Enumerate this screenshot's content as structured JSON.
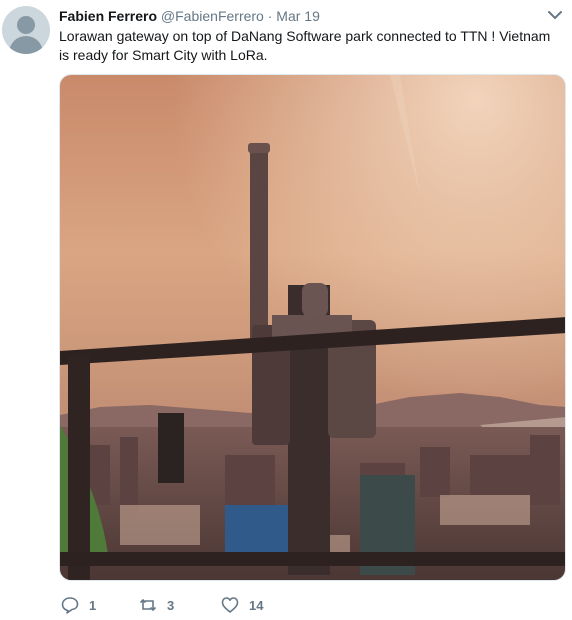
{
  "tweet": {
    "author_name": "Fabien Ferrero",
    "author_handle": "@FabienFerrero",
    "separator": "·",
    "timestamp": "Mar 19",
    "text": "Lorawan gateway on top of DaNang Software park connected to TTN ! Vietnam is ready for Smart City with LoRa."
  },
  "actions": {
    "reply_count": "1",
    "retweet_count": "3",
    "like_count": "14"
  },
  "icons": {
    "avatar": "default-avatar-icon",
    "menu": "chevron-down-icon",
    "reply": "reply-icon",
    "retweet": "retweet-icon",
    "like": "heart-icon"
  },
  "colors": {
    "name": "#14171a",
    "secondary": "#657786",
    "avatar_bg": "#ccd6dd",
    "icon": "#657786"
  }
}
